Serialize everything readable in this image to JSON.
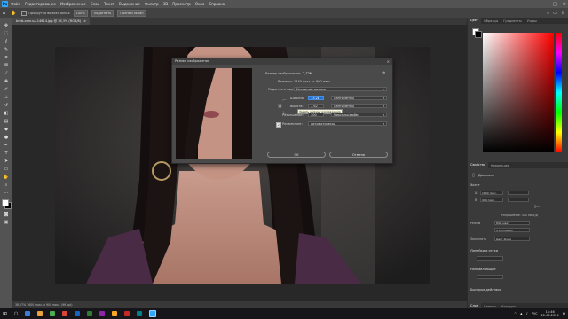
{
  "menubar": {
    "logo": "Ps",
    "items": [
      "Файл",
      "Редактирование",
      "Изображение",
      "Слои",
      "Текст",
      "Выделение",
      "Фильтр",
      "3D",
      "Просмотр",
      "Окно",
      "Справка"
    ],
    "window_controls": [
      "–",
      "□",
      "✕"
    ]
  },
  "options": {
    "prop_label": "Прокрутка во всех окнах",
    "zoom_value": "100%",
    "fit_label": "Подогнать",
    "fullscreen_label": "Полный экран"
  },
  "document": {
    "tab_title": "bnds.com.ua-14614.jpg @ 38,3% (RGB/8)",
    "status": "38,27%    1600 пикс. x 900 пикс. (96 ppi)"
  },
  "dialog": {
    "title": "Размер изображения",
    "image_size_label": "Размер изображения:",
    "image_size_value": "2,72M",
    "dimensions_label": "Размеры:",
    "dimensions_value": "1440 пикс. × 900 пикс.",
    "fit_to_label": "Подогнать под:",
    "fit_to_value": "Исходный размер",
    "width_label": "Ширина:",
    "width_value": "13,28",
    "width_unit": "Сантиметры",
    "height_label": "Высота:",
    "height_value": "7,62",
    "height_unit": "Сантиметры",
    "tooltip": "Задать ширину изображения",
    "resolution_label": "Разрешение:",
    "resolution_value": "300",
    "resolution_unit": "Пикселы/дюйм",
    "resample_label": "Ресамплинг:",
    "resample_value": "Автоматически",
    "ok_label": "OK",
    "cancel_label": "Отмена"
  },
  "panels": {
    "color_tabs": [
      "Цвет",
      "Образцы",
      "Градиенты",
      "Узоры"
    ],
    "props_tabs": [
      "Свойства",
      "Коррекция"
    ],
    "doc_label": "Документ",
    "canvas_section": "Холст",
    "w_label": "Ш",
    "w_value": "1600 пикс.",
    "h_label": "В",
    "h_value": "900 пикс.",
    "resolution_text": "Разрешение: 300 пикс/д",
    "mode_label": "Режим",
    "mode_value": "RGB цвет",
    "bits_value": "8 бит/канал",
    "bg_label": "Заполнить",
    "bg_value": "Цвет фона",
    "rulers_section": "Линейки и сетки",
    "guides_section": "Направляющие",
    "quick_section": "Быстрые действия",
    "layers_tabs": [
      "Слои",
      "Каналы",
      "Контуры"
    ]
  },
  "tray": {
    "lang": "РУС",
    "time": "11:46",
    "date": "22.06.2020"
  },
  "colors": {
    "accent": "#31a8ff",
    "dialog_bg": "#4a4a4a",
    "app_bg": "#2b2b2b"
  },
  "icons": {
    "tools": [
      "move-icon",
      "marquee-icon",
      "lasso-icon",
      "quick-select-icon",
      "crop-icon",
      "frame-icon",
      "eyedropper-icon",
      "healing-icon",
      "brush-icon",
      "stamp-icon",
      "history-brush-icon",
      "eraser-icon",
      "gradient-icon",
      "blur-icon",
      "dodge-icon",
      "pen-icon",
      "type-icon",
      "path-select-icon",
      "shape-icon",
      "hand-icon",
      "zoom-icon"
    ]
  }
}
